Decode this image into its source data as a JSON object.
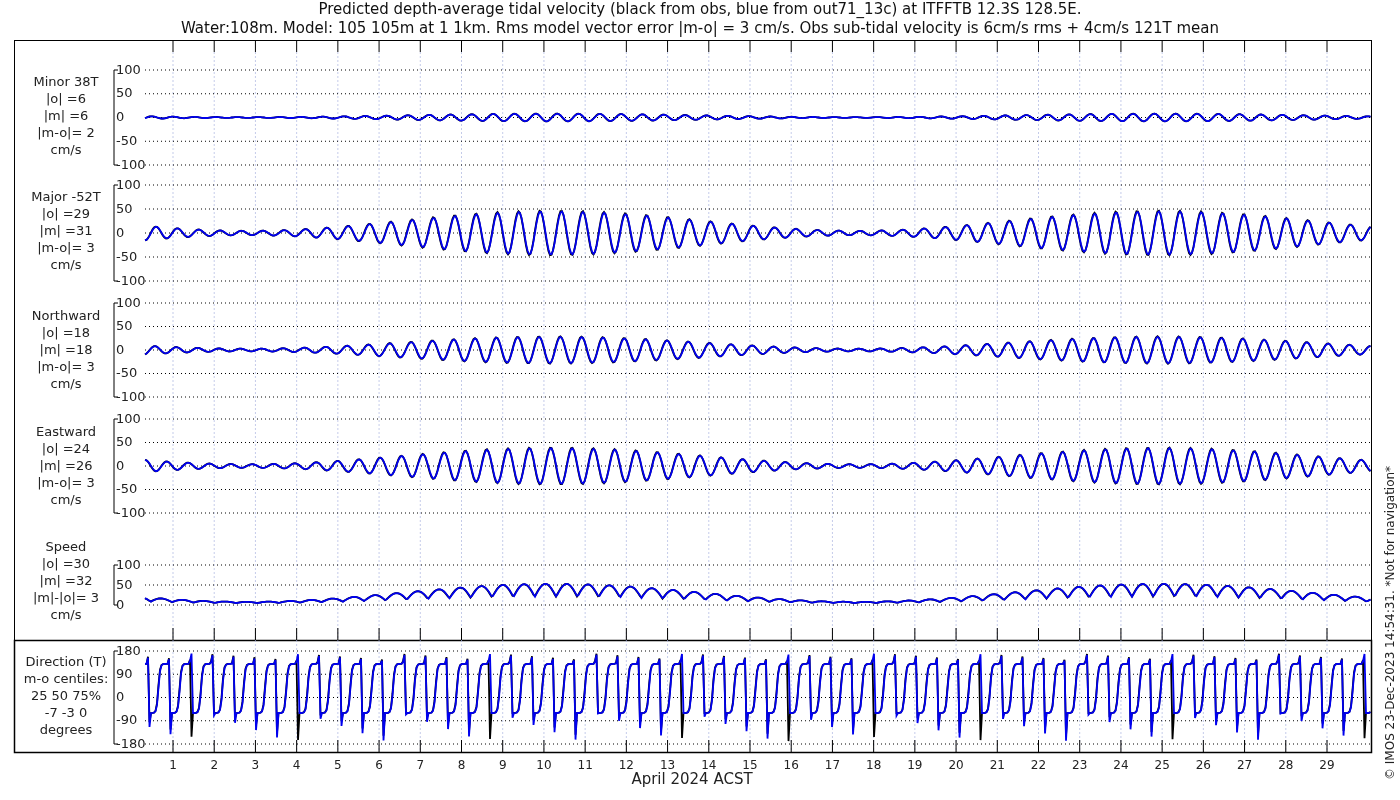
{
  "title": [
    "Predicted depth-average tidal velocity (black from obs, blue from out71_13c) at ITFFTB 12.3S 128.5E.",
    "Water:108m. Model: 105 105m at 1 1km. Rms model vector error |m-o| = 3 cm/s. Obs sub-tidal velocity is 6cm/s rms + 4cm/s 121T mean"
  ],
  "panels": [
    {
      "kind": "velocity",
      "labels": [
        "Minor 38T",
        "|o| =6",
        "|m| =6",
        "|m-o|= 2",
        "cm/s"
      ],
      "yticks": [
        "100",
        "50",
        "0",
        "-50",
        "-100"
      ]
    },
    {
      "kind": "velocity",
      "labels": [
        "Major -52T",
        "|o| =29",
        "|m| =31",
        "|m-o|= 3",
        "cm/s"
      ],
      "yticks": [
        "100",
        "50",
        "0",
        "-50",
        "-100"
      ]
    },
    {
      "kind": "velocity",
      "labels": [
        "Northward",
        "|o| =18",
        "|m| =18",
        "|m-o|= 3",
        "cm/s"
      ],
      "yticks": [
        "100",
        "50",
        "0",
        "-50",
        "-100"
      ]
    },
    {
      "kind": "velocity",
      "labels": [
        "Eastward",
        "|o| =24",
        "|m| =26",
        "|m-o|= 3",
        "cm/s"
      ],
      "yticks": [
        "100",
        "50",
        "0",
        "-50",
        "-100"
      ]
    },
    {
      "kind": "speed",
      "labels": [
        "Speed",
        "|o| =30",
        "|m| =32",
        "|m|-|o|= 3",
        "cm/s"
      ],
      "yticks": [
        "100",
        "50",
        "0"
      ]
    },
    {
      "kind": "direction",
      "labels": [
        "Direction (T)",
        "m-o centiles:",
        "25  50  75%",
        "-7 -3  0",
        "degrees"
      ],
      "yticks": [
        "180",
        "90",
        "0",
        "-90",
        "-180"
      ]
    }
  ],
  "days": [
    "1",
    "2",
    "3",
    "4",
    "5",
    "6",
    "7",
    "8",
    "9",
    "10",
    "11",
    "12",
    "13",
    "14",
    "15",
    "16",
    "17",
    "18",
    "19",
    "20",
    "21",
    "22",
    "23",
    "24",
    "25",
    "26",
    "27",
    "28",
    "29"
  ],
  "xlabel": "April 2024 ACST",
  "credit": "© IMOS 23-Dec-2023 14:54:31. *Not for navigation*"
}
